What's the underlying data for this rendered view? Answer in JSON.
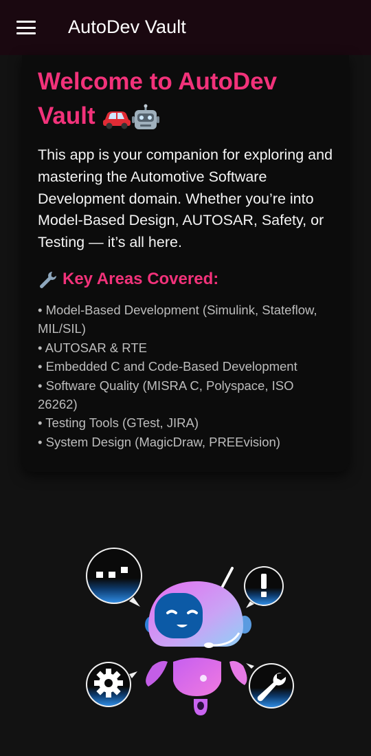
{
  "appbar": {
    "title": "AutoDev Vault",
    "menu_icon": "hamburger-menu-icon"
  },
  "welcome": {
    "title": "Welcome to AutoDev Vault",
    "title_emojis": [
      "car-icon",
      "robot-icon"
    ]
  },
  "intro": {
    "text": "This app is your companion for exploring and mastering the Automotive Software Development domain. Whether you’re into Model-Based Design, AUTOSAR, Safety, or Testing — it’s all here."
  },
  "key_areas": {
    "heading": "Key Areas Covered:",
    "heading_icon": "wrench-icon",
    "items": [
      "• Model-Based Development (Simulink, Stateflow, MIL/SIL)",
      "• AUTOSAR & RTE",
      "• Embedded C and Code-Based Development",
      "• Software Quality (MISRA C, Polyspace, ISO 26262)",
      "• Testing Tools (GTest, JIRA)",
      "• System Design (MagicDraw, PREEvision)"
    ]
  },
  "illustration": {
    "name": "robot-assistant-illustration",
    "colors": {
      "accent": "#f2327a",
      "robot_pink": "#d96cf0",
      "robot_blue": "#2f7fd8",
      "bubble_dark": "#0a0a0a"
    }
  }
}
